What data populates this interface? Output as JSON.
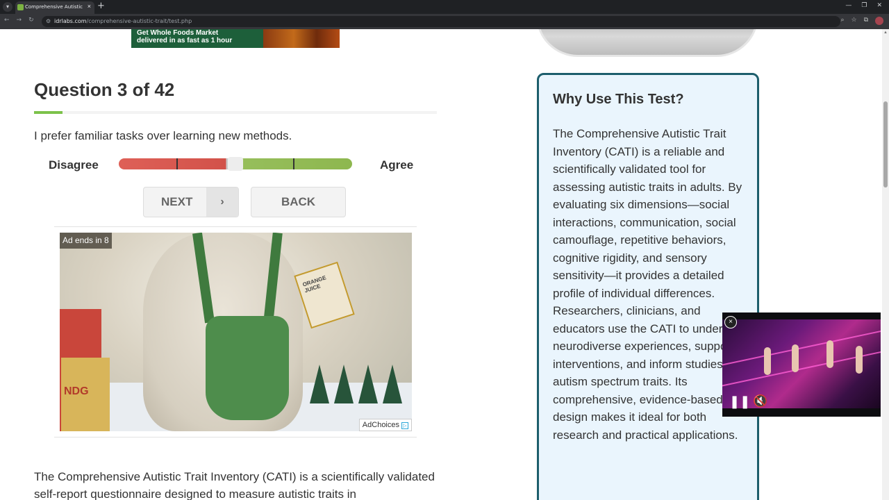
{
  "browser": {
    "tab_title": "Comprehensive Autistic Trait In",
    "tab_close": "×",
    "new_tab": "+",
    "url_host": "idrlabs.com",
    "url_path": "/comprehensive-autistic-trait/test.php",
    "window_controls": [
      "—",
      "❐",
      "✕"
    ],
    "nav": [
      "←",
      "→",
      "↻"
    ],
    "toolbar_icons": [
      "⌕",
      "☆",
      "⧉"
    ]
  },
  "banner_ad": {
    "line1": "Get Whole Foods Market",
    "line2": "delivered in as fast as 1 hour"
  },
  "quiz": {
    "title": "Question 3 of 42",
    "progress": 0.0714,
    "question": "I prefer familiar tasks over learning new methods.",
    "left_label": "Disagree",
    "right_label": "Agree",
    "slider_value": 0.5,
    "next_label": "NEXT",
    "next_chevron": "›",
    "back_label": "BACK"
  },
  "video_ad": {
    "countdown": "Ad ends in 8",
    "adchoices": "AdChoices",
    "carton_text": "ORANGE JUICE",
    "sign_text": "NDG"
  },
  "description": "The Comprehensive Autistic Trait Inventory (CATI) is a scientifically validated self-report questionnaire designed to measure autistic traits in",
  "sidebar": {
    "title": "Why Use This Test?",
    "body": "The Comprehensive Autistic Trait Inventory (CATI) is a reliable and scientifically validated tool for assessing autistic traits in adults. By evaluating six dimensions—social interactions, communication, social camouflage, repetitive behaviors, cognitive rigidity, and sensory sensitivity—it provides a detailed profile of individual differences. Researchers, clinicians, and educators use the CATI to understand neurodiverse experiences, support interventions, and inform studies on autism spectrum traits. Its comprehensive, evidence-based design makes it ideal for both research and practical applications."
  },
  "mini_player": {
    "close": "×",
    "pause": "❚❚",
    "mute": "🔇"
  }
}
